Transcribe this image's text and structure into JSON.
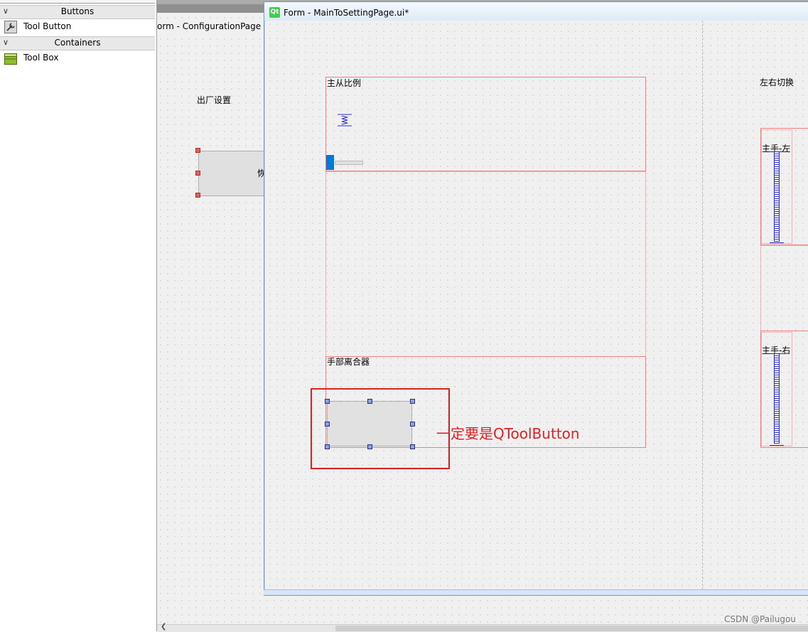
{
  "widget_box": {
    "categories": [
      {
        "label": "Buttons",
        "items": [
          {
            "label": "Tool Button",
            "icon": "tool-button-icon"
          }
        ]
      },
      {
        "label": "Containers",
        "items": [
          {
            "label": "Tool Box",
            "icon": "tool-box-icon"
          }
        ]
      }
    ]
  },
  "background_form": {
    "title": "orm - ConfigurationPage",
    "label": "出厂设置",
    "button_text_fragment": "恢"
  },
  "form_window": {
    "title": "Form - MainToSettingPage.ui*",
    "logo_text": "Qt",
    "groups": {
      "ratio_label": "主从比例",
      "hand_clutch_label": "手部离合器",
      "lr_switch_label": "左右切换",
      "master_left_label": "主手-左",
      "master_right_label": "主手-右"
    }
  },
  "annotation": {
    "text": "一定要是QToolButton",
    "color": "#e02020"
  },
  "watermark_credit": "CSDN @Pailugou",
  "colors": {
    "layout_frame": "#f08080",
    "slider_accent": "#0078d7",
    "qt_green": "#41cd52"
  }
}
